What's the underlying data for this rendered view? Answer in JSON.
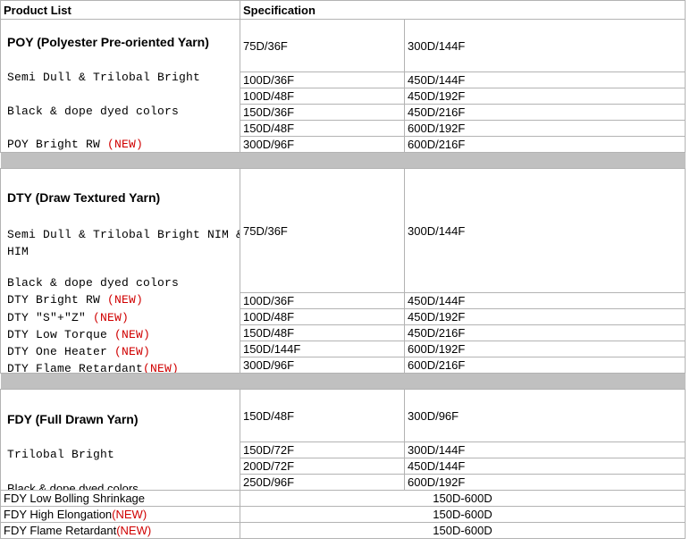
{
  "header": {
    "product_list": "Product List",
    "specification": "Specification"
  },
  "sections": [
    {
      "id": "poy",
      "title": "POY (Polyester Pre-oriented Yarn)",
      "desc_lines": [
        {
          "text": "Semi Dull & Trilobal Bright",
          "style": "mono"
        },
        {
          "text": "Black & dope dyed colors",
          "style": "mono"
        },
        {
          "text": " POY Bright RW ",
          "style": "mono",
          "tag": "(NEW)"
        }
      ],
      "specs": [
        {
          "left": "75D/36F",
          "right": "300D/144F"
        },
        {
          "left": "100D/36F",
          "right": "450D/144F"
        },
        {
          "left": "100D/48F",
          "right": "450D/192F"
        },
        {
          "left": "150D/36F",
          "right": "450D/216F"
        },
        {
          "left": "150D/48F",
          "right": "600D/192F"
        },
        {
          "left": "300D/96F",
          "right": "600D/216F"
        }
      ]
    },
    {
      "id": "dty",
      "title": "DTY (Draw Textured Yarn)",
      "desc_lines": [
        {
          "text": "Semi Dull & Trilobal Bright NIM &",
          "style": "mono"
        },
        {
          "text": "HIM",
          "style": "mono"
        },
        {
          "text": "Black & dope dyed colors",
          "style": "mono"
        },
        {
          "text": "DTY Bright RW ",
          "style": "mono",
          "tag": "(NEW)"
        },
        {
          "text": "DTY ″S″+″Z″ ",
          "style": "mono",
          "tag": "(NEW)"
        },
        {
          "text": "DTY Low Torque ",
          "style": "mono",
          "tag": "(NEW)"
        },
        {
          "text": "DTY One Heater ",
          "style": "mono",
          "tag": "(NEW)"
        },
        {
          "text": "DTY Flame Retardant",
          "style": "mono",
          "tag": "(NEW)"
        }
      ],
      "specs": [
        {
          "left": "75D/36F",
          "right": "300D/144F"
        },
        {
          "left": "100D/36F",
          "right": "450D/144F"
        },
        {
          "left": "100D/48F",
          "right": "450D/192F"
        },
        {
          "left": "150D/48F",
          "right": "450D/216F"
        },
        {
          "left": "150D/144F",
          "right": "600D/192F"
        },
        {
          "left": "300D/96F",
          "right": "600D/216F"
        }
      ]
    },
    {
      "id": "fdy",
      "title": "FDY (Full Drawn Yarn)",
      "desc_lines": [
        {
          "text": "Trilobal Bright",
          "style": "mono"
        },
        {
          "text": "Black & dope dyed colors",
          "style": "sans"
        }
      ],
      "specs": [
        {
          "left": "150D/48F",
          "right": "300D/96F"
        },
        {
          "left": "150D/72F",
          "right": "300D/144F"
        },
        {
          "left": "200D/72F",
          "right": "450D/144F"
        },
        {
          "left": "250D/96F",
          "right": "600D/192F"
        }
      ],
      "range_rows": [
        {
          "label": "FDY Low Bolling Shrinkage",
          "tag": "",
          "value": "150D-600D"
        },
        {
          "label": "FDY High Elongation",
          "tag": "(NEW)",
          "value": "150D-600D"
        },
        {
          "label": "FDY Flame Retardant",
          "tag": "(NEW)",
          "value": "150D-600D"
        }
      ]
    }
  ],
  "colors": {
    "band": "#c0c0c0",
    "grid_line": "#b3b3b3",
    "new_tag": "#d00000",
    "text": "#000000"
  }
}
